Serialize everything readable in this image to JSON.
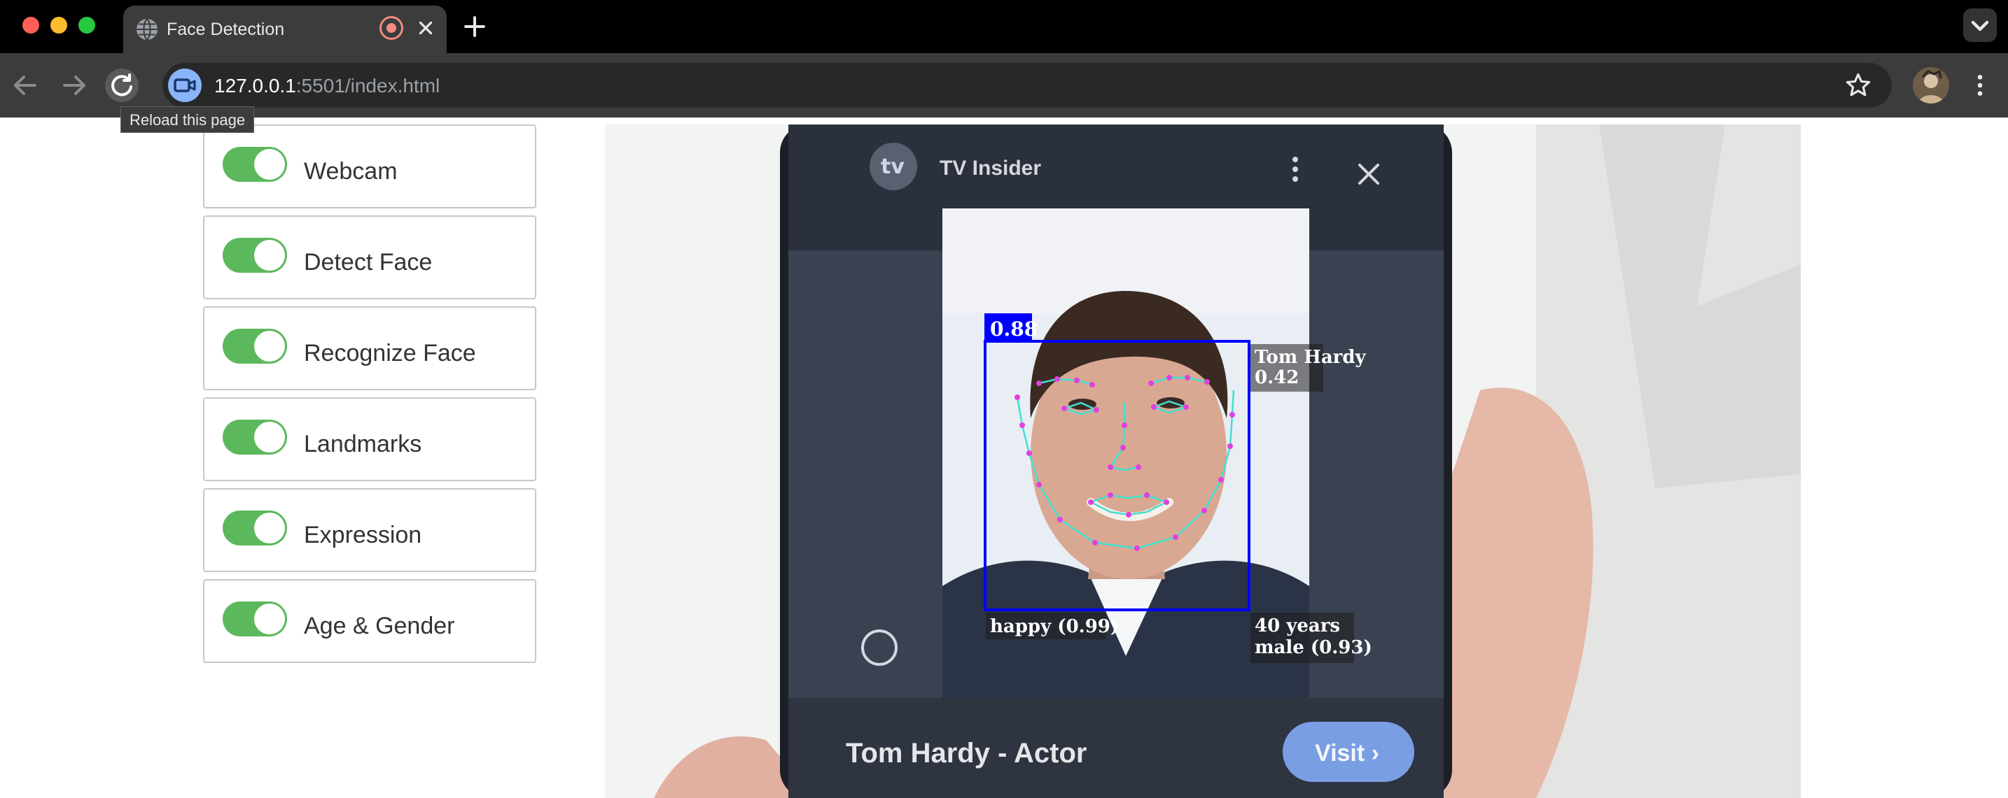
{
  "browser": {
    "tab_title": "Face Detection",
    "url_host": "127.0.0.1",
    "url_rest": ":5501/index.html",
    "reload_tooltip": "Reload this page",
    "icons": {
      "tab_favicon": "globe-icon",
      "recording": "recording-indicator-icon",
      "tab_close": "close-icon",
      "new_tab": "plus-icon",
      "tab_search": "chevron-down-icon",
      "back": "arrow-left-icon",
      "forward": "arrow-right-icon",
      "reload": "reload-icon",
      "camera": "camera-icon",
      "bookmark": "star-icon",
      "menu": "kebab-icon"
    }
  },
  "controls": [
    {
      "label": "Webcam",
      "checked": true
    },
    {
      "label": "Detect Face",
      "checked": true
    },
    {
      "label": "Recognize Face",
      "checked": true
    },
    {
      "label": "Landmarks",
      "checked": true
    },
    {
      "label": "Expression",
      "checked": true
    },
    {
      "label": "Age & Gender",
      "checked": true
    }
  ],
  "toggle_on_color": "#5cb85c",
  "video": {
    "phone_app_name": "TV Insider",
    "phone_caption": "Tom Hardy - Actor",
    "phone_visit_button": "Visit ›",
    "detection": {
      "score": "0.88",
      "name": "Tom Hardy",
      "name_confidence": "0.42",
      "expression": "happy (0.99)",
      "age": "40 years",
      "gender": "male (0.93)",
      "box_color": "#0000ff",
      "landmark_color": "#e040e0",
      "contour_color": "#40e0d0"
    }
  }
}
